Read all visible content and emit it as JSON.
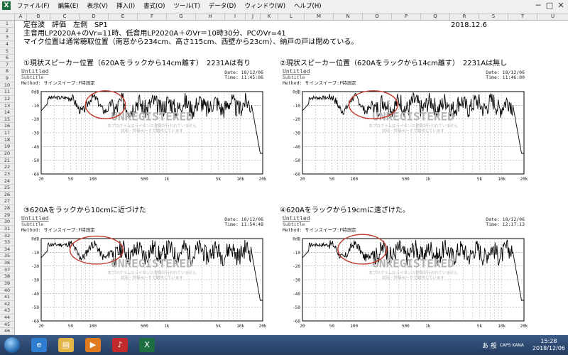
{
  "menubar": {
    "app_icon": "X",
    "items": [
      "ファイル(F)",
      "編集(E)",
      "表示(V)",
      "挿入(I)",
      "書式(O)",
      "ツール(T)",
      "データ(D)",
      "ウィンドウ(W)",
      "ヘルプ(H)"
    ],
    "window_controls": [
      "─",
      "□",
      "✕"
    ]
  },
  "columns": [
    "A",
    "B",
    "C",
    "D",
    "E",
    "F",
    "G",
    "H",
    "I",
    "J",
    "K",
    "L",
    "M",
    "N",
    "O",
    "P",
    "Q",
    "R",
    "S",
    "T",
    "U"
  ],
  "rows": [
    "1",
    "2",
    "3",
    "4",
    "5",
    "6",
    "7",
    "8",
    "9",
    "10",
    "11",
    "12",
    "13",
    "14",
    "15",
    "16",
    "17",
    "18",
    "19",
    "20",
    "21",
    "22",
    "23",
    "24",
    "25",
    "26",
    "27",
    "28",
    "29",
    "30",
    "31",
    "32",
    "33",
    "34",
    "35",
    "36",
    "37",
    "38",
    "39",
    "40",
    "41",
    "42",
    "43",
    "44",
    "45",
    "46"
  ],
  "sheet": {
    "line1": "定在波　評価　左側　SP1",
    "date": "2018.12.6",
    "line2": "主音用LP2020A+のVr=11時、低音用LP2020A＋のVr＝10時30分、PCのVr=41",
    "line3": "マイク位置は通常聴取位置（南窓から234cm、高さ115cm、西壁から23cm）、納戸の戸は閉めている。"
  },
  "panels": [
    {
      "heading": "①現状スピーカー位置（620Aをラックから14cm離す）　2231Aは有り",
      "untitled": "Untitled",
      "subtitle": "Subtitle",
      "method": "Method: サインスイープ:F特測定",
      "date": "Date: 18/12/06",
      "time": "Time: 11:45:06"
    },
    {
      "heading": "②現状スピーカー位置（620Aをラックから14cm離す）　2231Aは無し",
      "untitled": "Untitled",
      "subtitle": "Subtitle",
      "method": "Method: サインスイープ:F特測定",
      "date": "Date: 18/12/06",
      "time": "Time: 11:46:00"
    },
    {
      "heading": "③620Aをラックから10cmに近づけた",
      "untitled": "Untitled",
      "subtitle": "Subtitle",
      "method": "Method: サインスイープ:F特測定",
      "date": "Date: 18/12/06",
      "time": "Time: 11:54:48"
    },
    {
      "heading": "④620Aをラックから19cmに遠ざけた。",
      "untitled": "Untitled",
      "subtitle": "Subtitle",
      "method": "Method: サインスイープ:F特測定",
      "date": "Date: 18/12/06",
      "time": "Time: 12:17:13"
    }
  ],
  "plot_axes": {
    "y_ticks": [
      "0dB",
      "-10",
      "-20",
      "-30",
      "-40",
      "-50",
      "-60"
    ],
    "x_ticks": [
      "20",
      "50",
      "100",
      "500",
      "1k",
      "5k",
      "10k",
      "20k"
    ],
    "watermark": "UNREGISTERED",
    "watermark_sub1": "本プログラムはライセンス登録が行われていません",
    "watermark_sub2": "試用・評価モードで動作しています"
  },
  "taskbar": {
    "ime": "あ 般",
    "time": "15:28",
    "date": "2018/12/06",
    "locale": "CAPS KANA"
  }
}
